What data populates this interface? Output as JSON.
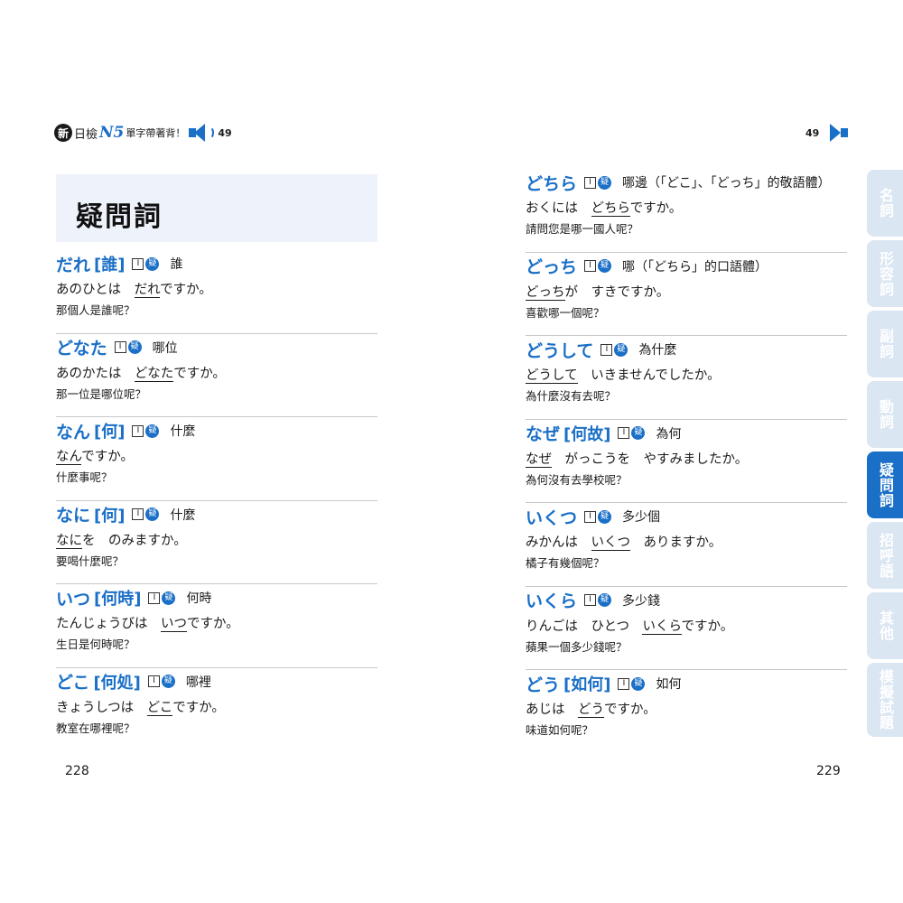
{
  "header_left": {
    "badge": "新",
    "series": "日檢",
    "level": "N5",
    "subtitle": "單字帶著背！",
    "track": "49"
  },
  "header_right": {
    "track": "49"
  },
  "category_title": "疑問詞",
  "tag_box": "I",
  "tag_circle": "疑",
  "left_entries": [
    {
      "word": "だれ",
      "kanji": "[誰]",
      "meaning": "誰",
      "ex_pre": "あのひとは　",
      "ex_u": "だれ",
      "ex_post": "ですか。",
      "trans": "那個人是誰呢？"
    },
    {
      "word": "どなた",
      "kanji": "",
      "meaning": "哪位",
      "ex_pre": "あのかたは　",
      "ex_u": "どなた",
      "ex_post": "ですか。",
      "trans": "那一位是哪位呢？"
    },
    {
      "word": "なん",
      "kanji": "[何]",
      "meaning": "什麼",
      "ex_pre": "",
      "ex_u": "なん",
      "ex_post": "ですか。",
      "trans": "什麼事呢？"
    },
    {
      "word": "なに",
      "kanji": "[何]",
      "meaning": "什麼",
      "ex_pre": "",
      "ex_u": "なに",
      "ex_post": "を　のみますか。",
      "trans": "要喝什麼呢？"
    },
    {
      "word": "いつ",
      "kanji": "[何時]",
      "meaning": "何時",
      "ex_pre": "たんじょうびは　",
      "ex_u": "いつ",
      "ex_post": "ですか。",
      "trans": "生日是何時呢？"
    },
    {
      "word": "どこ",
      "kanji": "[何処]",
      "meaning": "哪裡",
      "ex_pre": "きょうしつは　",
      "ex_u": "どこ",
      "ex_post": "ですか。",
      "trans": "教室在哪裡呢？"
    }
  ],
  "right_entries": [
    {
      "word": "どちら",
      "kanji": "",
      "meaning": "哪邊（「どこ」、「どっち」的敬語體）",
      "ex_pre": "おくには　",
      "ex_u": "どちら",
      "ex_post": "ですか。",
      "trans": "請問您是哪一國人呢？"
    },
    {
      "word": "どっち",
      "kanji": "",
      "meaning": "哪（「どちら」的口語體）",
      "ex_pre": "",
      "ex_u": "どっち",
      "ex_post": "が　すきですか。",
      "trans": "喜歡哪一個呢？"
    },
    {
      "word": "どうして",
      "kanji": "",
      "meaning": "為什麼",
      "ex_pre": "",
      "ex_u": "どうして",
      "ex_post": "　いきませんでしたか。",
      "trans": "為什麼沒有去呢？"
    },
    {
      "word": "なぜ",
      "kanji": "[何故]",
      "meaning": "為何",
      "ex_pre": "",
      "ex_u": "なぜ",
      "ex_post": "　がっこうを　やすみましたか。",
      "trans": "為何沒有去學校呢？"
    },
    {
      "word": "いくつ",
      "kanji": "",
      "meaning": "多少個",
      "ex_pre": "みかんは　",
      "ex_u": "いくつ",
      "ex_post": "　ありますか。",
      "trans": "橘子有幾個呢？"
    },
    {
      "word": "いくら",
      "kanji": "",
      "meaning": "多少錢",
      "ex_pre": "りんごは　ひとつ　",
      "ex_u": "いくら",
      "ex_post": "ですか。",
      "trans": "蘋果一個多少錢呢？"
    },
    {
      "word": "どう",
      "kanji": "[如何]",
      "meaning": "如何",
      "ex_pre": "あじは　",
      "ex_u": "どう",
      "ex_post": "ですか。",
      "trans": "味道如何呢？"
    }
  ],
  "page_left": "228",
  "page_right": "229",
  "tabs": [
    {
      "label": "名詞",
      "active": false
    },
    {
      "label": "形容詞",
      "active": false
    },
    {
      "label": "副詞",
      "active": false
    },
    {
      "label": "動詞",
      "active": false
    },
    {
      "label": "疑問詞",
      "active": true
    },
    {
      "label": "招呼語",
      "active": false
    },
    {
      "label": "其他",
      "active": false
    },
    {
      "label": "模擬試題",
      "active": false
    }
  ],
  "colors": {
    "accent": "#1a6fc7",
    "tab_inactive": "#dbe6f3",
    "title_bg": "#eef3fb"
  }
}
